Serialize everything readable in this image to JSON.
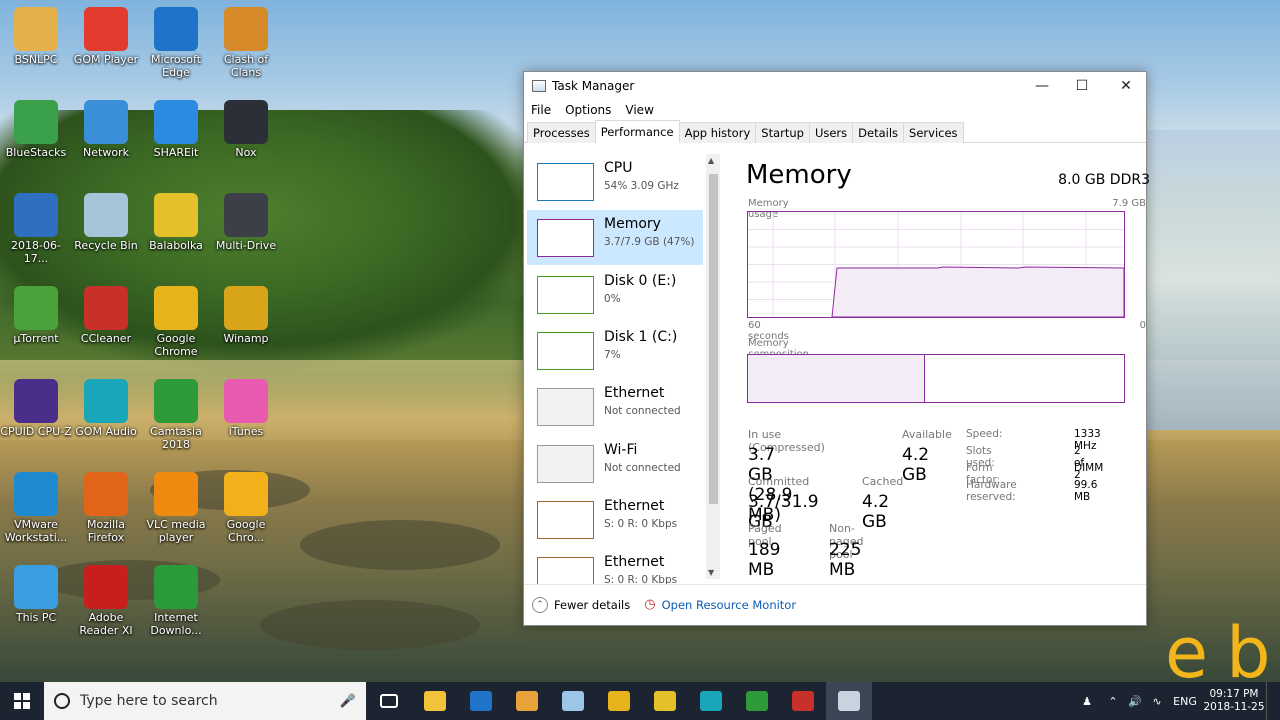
{
  "desktop": {
    "icons": [
      {
        "label": "BSNLPC",
        "color": "#e4b04a"
      },
      {
        "label": "GOM Player",
        "color": "#e33b2e"
      },
      {
        "label": "Microsoft Edge",
        "color": "#1f74c9"
      },
      {
        "label": "Clash of Clans",
        "color": "#d68a2a"
      },
      {
        "label": "BlueStacks",
        "color": "#3aa04a"
      },
      {
        "label": "Network",
        "color": "#3b8ed8"
      },
      {
        "label": "SHAREit",
        "color": "#2b8be0"
      },
      {
        "label": "Nox",
        "color": "#2c2f38"
      },
      {
        "label": "2018-06-17...",
        "color": "#2e6fc0"
      },
      {
        "label": "Recycle Bin",
        "color": "#a8c4d8"
      },
      {
        "label": "Balabolka",
        "color": "#e2c12a"
      },
      {
        "label": "Multi-Drive",
        "color": "#3c3f48"
      },
      {
        "label": "µTorrent",
        "color": "#4aa23a"
      },
      {
        "label": "CCleaner",
        "color": "#c8302a"
      },
      {
        "label": "Google Chrome",
        "color": "#e8b21a"
      },
      {
        "label": "Winamp",
        "color": "#d8a41a"
      },
      {
        "label": "CPUID CPU-Z",
        "color": "#4a2f8a"
      },
      {
        "label": "GOM Audio",
        "color": "#18a6b8"
      },
      {
        "label": "Camtasia 2018",
        "color": "#2f9a3a"
      },
      {
        "label": "iTunes",
        "color": "#e85ab0"
      },
      {
        "label": "VMware Workstati...",
        "color": "#1f8ad0"
      },
      {
        "label": "Mozilla Firefox",
        "color": "#e2651a"
      },
      {
        "label": "VLC media player",
        "color": "#ef8a10"
      },
      {
        "label": "Google Chro...",
        "color": "#f2b01a"
      },
      {
        "label": "This PC",
        "color": "#3a9ee0"
      },
      {
        "label": "Adobe Reader XI",
        "color": "#c81e1e"
      },
      {
        "label": "Internet Downlo...",
        "color": "#2a9a3a"
      }
    ],
    "watermark": "eb"
  },
  "window": {
    "title": "Task Manager",
    "menu": [
      "File",
      "Options",
      "View"
    ],
    "tabs": [
      "Processes",
      "Performance",
      "App history",
      "Startup",
      "Users",
      "Details",
      "Services"
    ],
    "resources": [
      {
        "name": "CPU",
        "sub": "54%  3.09 GHz",
        "color": "#1b7ab8"
      },
      {
        "name": "Memory",
        "sub": "3.7/7.9 GB (47%)",
        "color": "#8e2aa0"
      },
      {
        "name": "Disk 0 (E:)",
        "sub": "0%",
        "color": "#4c9a2a"
      },
      {
        "name": "Disk 1 (C:)",
        "sub": "7%",
        "color": "#4c9a2a"
      },
      {
        "name": "Ethernet",
        "sub": "Not connected",
        "color": "#999999"
      },
      {
        "name": "Wi-Fi",
        "sub": "Not connected",
        "color": "#999999"
      },
      {
        "name": "Ethernet",
        "sub": "S: 0  R: 0 Kbps",
        "color": "#a7652a"
      },
      {
        "name": "Ethernet",
        "sub": "S: 0  R: 0 Kbps",
        "color": "#a7652a"
      }
    ],
    "detail": {
      "title": "Memory",
      "spec": "8.0 GB DDR3",
      "usage_label": "Memory usage",
      "usage_max": "7.9 GB",
      "axis_left": "60 seconds",
      "axis_right": "0",
      "composition_label": "Memory composition",
      "composition_in_use_fraction": 0.47,
      "stats": {
        "in_use_label": "In use (Compressed)",
        "in_use": "3.7 GB (28.9 MB)",
        "available_label": "Available",
        "available": "4.2 GB",
        "committed_label": "Committed",
        "committed": "3.7/31.9 GB",
        "cached_label": "Cached",
        "cached": "4.2 GB",
        "paged_label": "Paged pool",
        "paged": "189 MB",
        "nonpaged_label": "Non-paged pool",
        "nonpaged": "225 MB"
      },
      "hardware": [
        {
          "label": "Speed:",
          "value": "1333 MHz"
        },
        {
          "label": "Slots used:",
          "value": "2 of 2"
        },
        {
          "label": "Form factor:",
          "value": "DIMM"
        },
        {
          "label": "Hardware reserved:",
          "value": "99.6 MB"
        }
      ]
    },
    "footer": {
      "fewer": "Fewer details",
      "monitor": "Open Resource Monitor"
    }
  },
  "taskbar": {
    "search_placeholder": "Type here to search",
    "apps": [
      {
        "name": "task-view",
        "color": "#1b2430"
      },
      {
        "name": "file-explorer",
        "color": "#f2c33a"
      },
      {
        "name": "edge",
        "color": "#1f74c9"
      },
      {
        "name": "media",
        "color": "#e8a23a"
      },
      {
        "name": "notes",
        "color": "#9bc6e8"
      },
      {
        "name": "chrome",
        "color": "#e8b21a"
      },
      {
        "name": "balabolka",
        "color": "#e2c12a"
      },
      {
        "name": "gom-audio",
        "color": "#18a6b8"
      },
      {
        "name": "camtasia",
        "color": "#2f9a3a"
      },
      {
        "name": "ccleaner",
        "color": "#c8302a"
      },
      {
        "name": "task-manager",
        "color": "#c9d3dd"
      }
    ],
    "lang": "ENG",
    "time": "09:17 PM",
    "date": "2018-11-25"
  }
}
